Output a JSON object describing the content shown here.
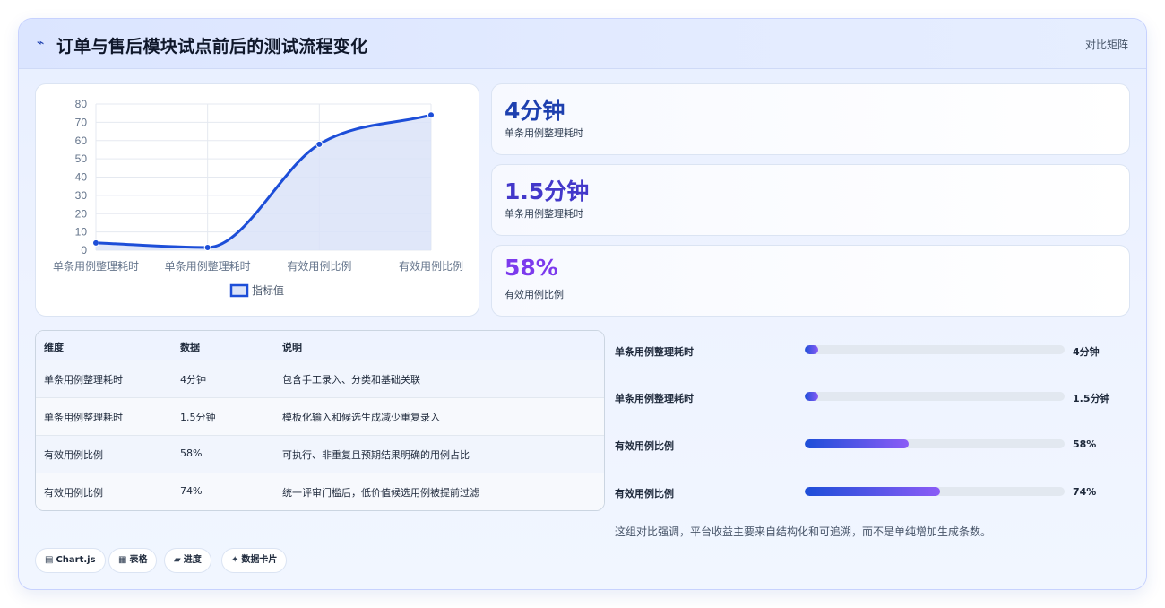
{
  "header": {
    "title": "订单与售后模块试点前后的测试流程变化",
    "toggle_label": "对比矩阵"
  },
  "chart_data": {
    "type": "line",
    "categories": [
      "单条用例整理耗时",
      "单条用例整理耗时",
      "有效用例比例",
      "有效用例比例"
    ],
    "series": [
      {
        "name": "指标值",
        "values": [
          4,
          1.5,
          58,
          74
        ]
      }
    ],
    "ylim": [
      0,
      80
    ],
    "yticks": [
      0,
      10,
      20,
      30,
      40,
      50,
      60,
      70,
      80
    ],
    "legend": "bottom",
    "grid": true,
    "fill": true,
    "colors": {
      "line": "#1d4ed8",
      "fill": "#dbe3f8"
    }
  },
  "stats": [
    {
      "value": "4分钟",
      "label": "单条用例整理耗时",
      "color": "#1e40af"
    },
    {
      "value": "1.5分钟",
      "label": "单条用例整理耗时",
      "color": "#4338ca"
    },
    {
      "value": "58%",
      "label": "有效用例比例",
      "color": "#7c3aed"
    }
  ],
  "table": {
    "headers": [
      "维度",
      "数据",
      "说明"
    ],
    "rows": [
      {
        "dimension": "单条用例整理耗时",
        "value": "4分钟",
        "desc": "包含手工录入、分类和基础关联"
      },
      {
        "dimension": "单条用例整理耗时",
        "value": "1.5分钟",
        "desc": "模板化输入和候选生成减少重复录入"
      },
      {
        "dimension": "有效用例比例",
        "value": "58%",
        "desc": "可执行、非重复且预期结果明确的用例占比"
      },
      {
        "dimension": "有效用例比例",
        "value": "74%",
        "desc": "统一评审门槛后，低价值候选用例被提前过滤"
      }
    ]
  },
  "progress": [
    {
      "label": "单条用例整理耗时",
      "value": "4分钟",
      "fraction": 0.05
    },
    {
      "label": "单条用例整理耗时",
      "value": "1.5分钟",
      "fraction": 0.05
    },
    {
      "label": "有效用例比例",
      "value": "58%",
      "fraction": 0.4
    },
    {
      "label": "有效用例比例",
      "value": "74%",
      "fraction": 0.52
    }
  ],
  "note": "这组对比强调，平台收益主要来自结构化和可追溯，而不是单纯增加生成条数。",
  "badges": [
    {
      "icon": "▤",
      "label": "Chart.js"
    },
    {
      "icon": "▦",
      "label": "表格"
    },
    {
      "icon": "▰",
      "label": "进度"
    },
    {
      "icon": "✦",
      "label": "数据卡片"
    }
  ]
}
